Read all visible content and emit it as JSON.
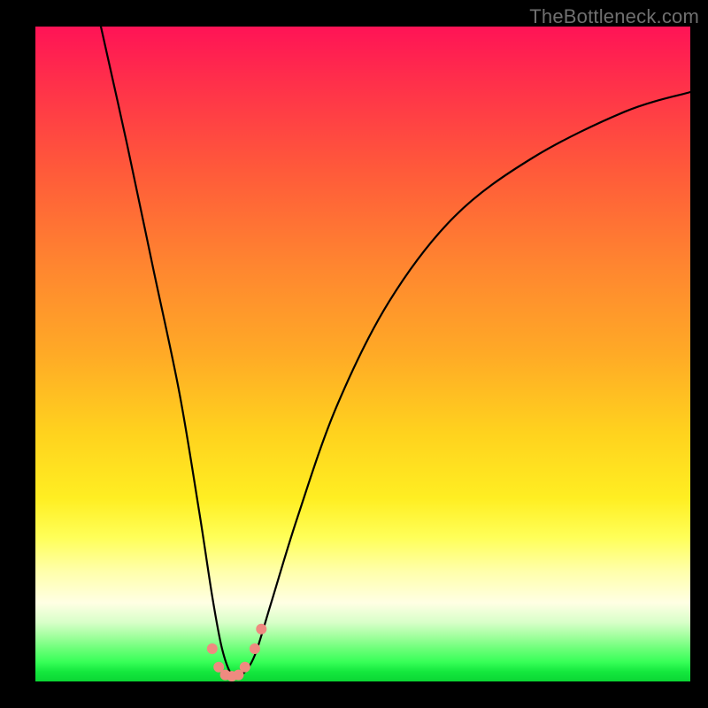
{
  "watermark": "TheBottleneck.com",
  "chart_data": {
    "type": "line",
    "title": "",
    "xlabel": "",
    "ylabel": "",
    "xlim": [
      0,
      100
    ],
    "ylim": [
      0,
      100
    ],
    "series": [
      {
        "name": "bottleneck-curve",
        "x": [
          10,
          14,
          18,
          22,
          25,
          27,
          28.5,
          30,
          31.5,
          33.5,
          36,
          40,
          46,
          54,
          64,
          76,
          90,
          100
        ],
        "values": [
          100,
          82,
          63,
          44,
          26,
          13,
          5,
          1,
          1,
          4,
          12,
          25,
          42,
          58,
          71,
          80,
          87,
          90
        ]
      }
    ],
    "markers": {
      "name": "salmon-dots",
      "color": "#ef8a80",
      "points": [
        {
          "x": 27.0,
          "y": 5.0
        },
        {
          "x": 28.0,
          "y": 2.2
        },
        {
          "x": 29.0,
          "y": 1.0
        },
        {
          "x": 30.0,
          "y": 0.8
        },
        {
          "x": 31.0,
          "y": 1.0
        },
        {
          "x": 32.0,
          "y": 2.2
        },
        {
          "x": 33.5,
          "y": 5.0
        },
        {
          "x": 34.5,
          "y": 8.0
        }
      ]
    },
    "background_gradient": {
      "top": "#ff1356",
      "mid_upper": "#ff8430",
      "mid": "#ffee22",
      "pale": "#ffffe4",
      "green_band": "#a4ffa0",
      "bottom": "#0bd634"
    }
  }
}
